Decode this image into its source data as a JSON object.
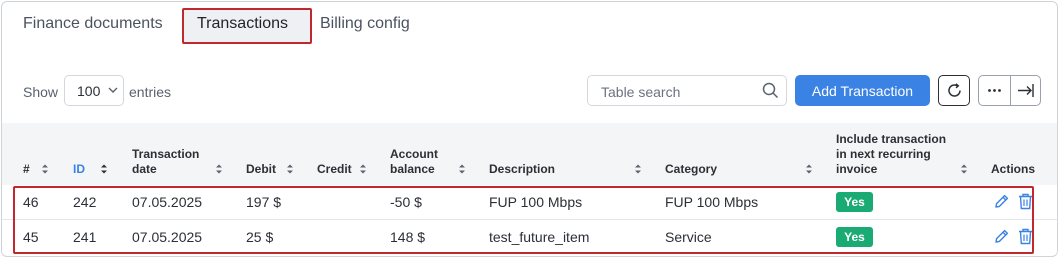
{
  "tabs": [
    {
      "label": "Finance documents"
    },
    {
      "label": "Transactions"
    },
    {
      "label": "Billing config"
    }
  ],
  "toolbar": {
    "show_label": "Show",
    "entries_value": "100",
    "entries_label": "entries",
    "search_placeholder": "Table search",
    "add_label": "Add Transaction"
  },
  "table": {
    "headers": {
      "num": "#",
      "id": "ID",
      "date_l1": "Transaction",
      "date_l2": "date",
      "debit": "Debit",
      "credit": "Credit",
      "balance_l1": "Account",
      "balance_l2": "balance",
      "description": "Description",
      "category": "Category",
      "include_l1": "Include transaction",
      "include_l2": "in next recurring",
      "include_l3": "invoice",
      "actions": "Actions"
    },
    "rows": [
      {
        "num": "46",
        "id": "242",
        "date": "07.05.2025",
        "debit": "197 $",
        "credit": "",
        "balance": "-50 $",
        "description": "FUP 100 Mbps",
        "category": "FUP 100 Mbps",
        "include": "Yes"
      },
      {
        "num": "45",
        "id": "241",
        "date": "07.05.2025",
        "debit": "25 $",
        "credit": "",
        "balance": "148 $",
        "description": "test_future_item",
        "category": "Service",
        "include": "Yes"
      }
    ]
  },
  "colors": {
    "accent": "#3a82e4",
    "success": "#1aaa73",
    "highlight": "#c0282d"
  },
  "icons": [
    "chevron-down-icon",
    "search-icon",
    "refresh-icon",
    "more-icon",
    "expand-icon",
    "sort-icon",
    "edit-icon",
    "trash-icon"
  ]
}
